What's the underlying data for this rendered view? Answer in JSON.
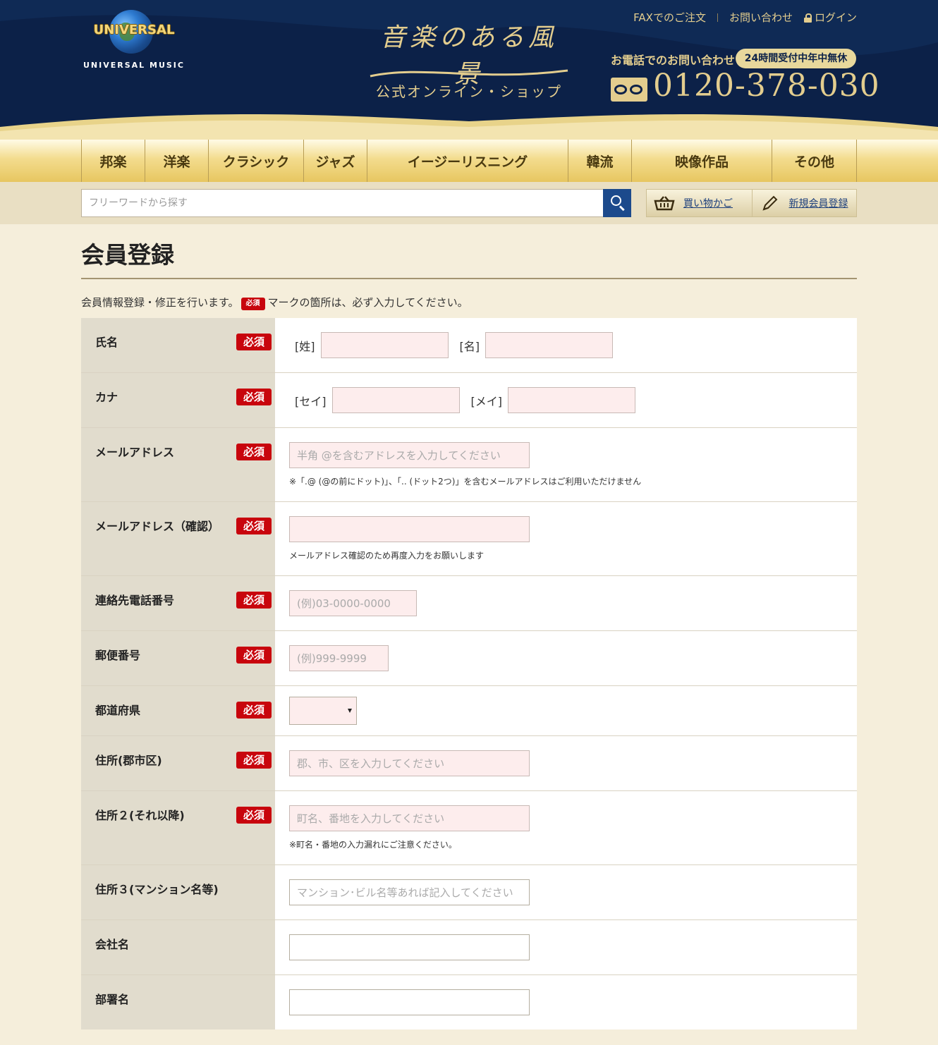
{
  "header": {
    "logo_text": "UNIVERSAL",
    "logo_subtext": "UNIVERSAL MUSIC",
    "brand_title": "音楽のある風景",
    "brand_subtitle": "公式オンライン・ショップ",
    "links": {
      "fax": "FAXでのご注文",
      "contact": "お問い合わせ",
      "login": "ログイン"
    },
    "phone_label": "お電話でのお問い合わせ",
    "phone_badge": "24時間受付中年中無休",
    "phone_number": "0120-378-030"
  },
  "nav": {
    "items": [
      {
        "label": "邦楽"
      },
      {
        "label": "洋楽"
      },
      {
        "label": "クラシック"
      },
      {
        "label": "ジャズ"
      },
      {
        "label": "イージーリスニング"
      },
      {
        "label": "韓流"
      },
      {
        "label": "映像作品"
      },
      {
        "label": "その他"
      }
    ]
  },
  "search": {
    "placeholder": "フリーワードから探す",
    "cart_label": "買い物かご",
    "register_label": "新規会員登録"
  },
  "page": {
    "title": "会員登録",
    "intro_before": "会員情報登録・修正を行います。",
    "intro_badge": "必須",
    "intro_after": "マークの箇所は、必ず入力してください。"
  },
  "form": {
    "required_label": "必須",
    "name": {
      "label": "氏名",
      "last": "[姓]",
      "first": "[名]"
    },
    "kana": {
      "label": "カナ",
      "last": "[セイ]",
      "first": "[メイ]"
    },
    "email": {
      "label": "メールアドレス",
      "placeholder": "半角 @を含むアドレスを入力してください",
      "hint": "※「.@ (@の前にドット)」、「.. (ドット2つ)」を含むメールアドレスはご利用いただけません"
    },
    "email_confirm": {
      "label": "メールアドレス（確認）",
      "hint": "メールアドレス確認のため再度入力をお願いします"
    },
    "phone": {
      "label": "連絡先電話番号",
      "placeholder": "(例)03-0000-0000"
    },
    "zip": {
      "label": "郵便番号",
      "placeholder": "(例)999-9999"
    },
    "prefecture": {
      "label": "都道府県",
      "value": ""
    },
    "address1": {
      "label": "住所(郡市区)",
      "placeholder": "郡、市、区を入力してください"
    },
    "address2": {
      "label": "住所２(それ以降)",
      "placeholder": "町名、番地を入力してください",
      "hint": "※町名・番地の入力漏れにご注意ください。"
    },
    "address3": {
      "label": "住所３(マンション名等)",
      "placeholder": "マンション･ビル名等あれば記入してください"
    },
    "company": {
      "label": "会社名"
    },
    "department": {
      "label": "部署名"
    }
  },
  "colors": {
    "header_navy": "#0c2148",
    "gold": "#e3cd8e",
    "required_red": "#c8050d",
    "background": "#f5eedb"
  }
}
